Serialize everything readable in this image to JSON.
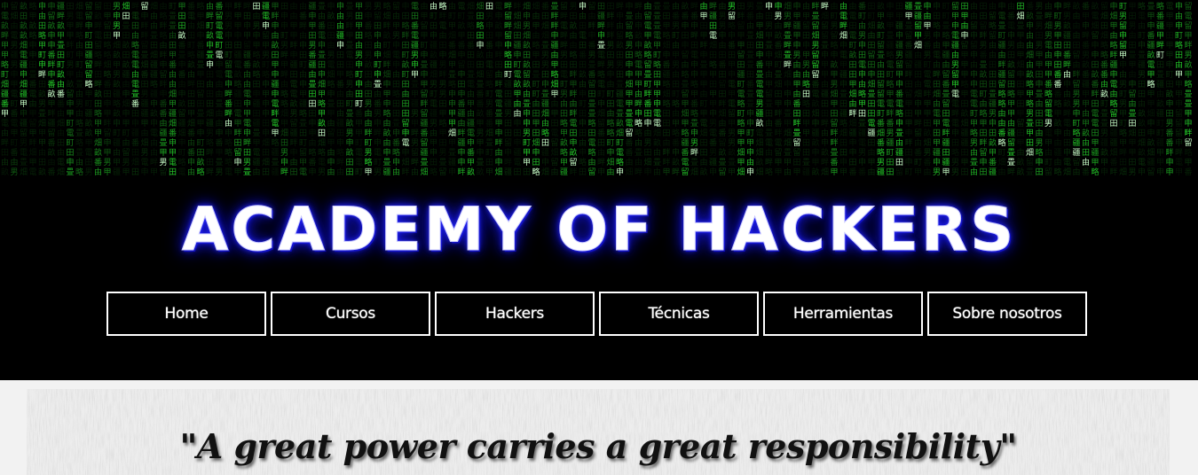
{
  "banner": {
    "rain_color": "#25d42b",
    "rain_glyphs": "田甲申由電畑男町畝畔留略番畳疆田甲申由"
  },
  "header": {
    "title": "ACADEMY OF HACKERS",
    "glow_color": "#1414d8"
  },
  "nav": {
    "items": [
      {
        "label": "Home"
      },
      {
        "label": "Cursos"
      },
      {
        "label": "Hackers"
      },
      {
        "label": "Técnicas"
      },
      {
        "label": "Herramientas"
      },
      {
        "label": "Sobre nosotros"
      }
    ]
  },
  "main": {
    "quote": "\"A great power carries a great responsibility\""
  }
}
